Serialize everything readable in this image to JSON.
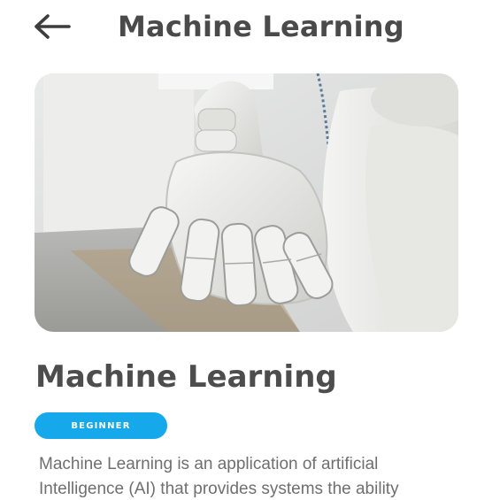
{
  "header": {
    "back_icon": "arrow-left-icon",
    "title": "Machine Learning"
  },
  "hero_image": {
    "subject": "robot-hand-image"
  },
  "content": {
    "title": "Machine Learning",
    "level_badge": "BEGINNER",
    "description": "Machine Learning is an application of artificial Intelligence (AI) that provides systems the ability"
  },
  "colors": {
    "title_text": "#4a4a4a",
    "badge_background": "#15a8ea",
    "badge_text": "#ffffff",
    "body_text": "#6f6f6f"
  }
}
